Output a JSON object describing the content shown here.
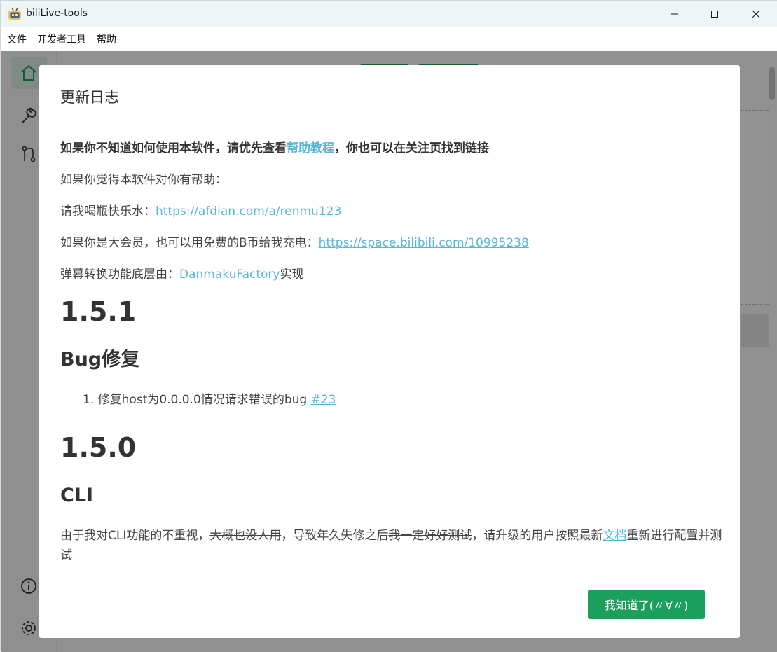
{
  "window": {
    "title": "biliLive-tools",
    "minimize": "—",
    "maximize": "☐",
    "close": "✕"
  },
  "menu": [
    "文件",
    "开发者工具",
    "帮助"
  ],
  "sidebar": {
    "icons": [
      "home-icon",
      "wrench-icon",
      "git-compare-icon",
      "info-icon",
      "settings-icon"
    ],
    "accent": "#1aa05a"
  },
  "dialog": {
    "title": "更新日志",
    "intro_prefix": "如果你不知道如何使用本软件，请优先查看",
    "intro_link": "帮助教程",
    "intro_suffix": "，你也可以在关注页找到链接",
    "help_line": "如果你觉得本软件对你有帮助：",
    "afdian_prefix": "请我喝瓶快乐水：",
    "afdian_link": "https://afdian.com/a/renmu123",
    "bili_prefix": "如果你是大会员，也可以用免费的B币给我充电：",
    "bili_link": "https://space.bilibili.com/10995238",
    "danmaku_prefix": "弹幕转换功能底层由：",
    "danmaku_link": "DanmakuFactory",
    "danmaku_suffix": "实现",
    "v151": "1.5.1",
    "bugfix_heading": "Bug修复",
    "bugfix_item_num": "1.",
    "bugfix_item": "修复host为0.0.0.0情况请求错误的bug ",
    "bugfix_item_link": "#23",
    "v150": "1.5.0",
    "cli_heading": "CLI",
    "cli_text_prefix": "由于我对CLI功能的不重视，",
    "cli_text_strike": "大概也没人用",
    "cli_text_mid": "，导致年久失修之后",
    "cli_text_strike2": "我一定好好测试",
    "cli_text_mid2": "，请升级的用户按照最新",
    "cli_text_link": "文档",
    "cli_text_suffix": "重新进行配置并测试",
    "ok_button": "我知道了(〃∀〃)"
  },
  "colors": {
    "link": "#56b7d9",
    "button": "#1aa05a",
    "overlay": "rgba(0,0,0,0.42)"
  }
}
